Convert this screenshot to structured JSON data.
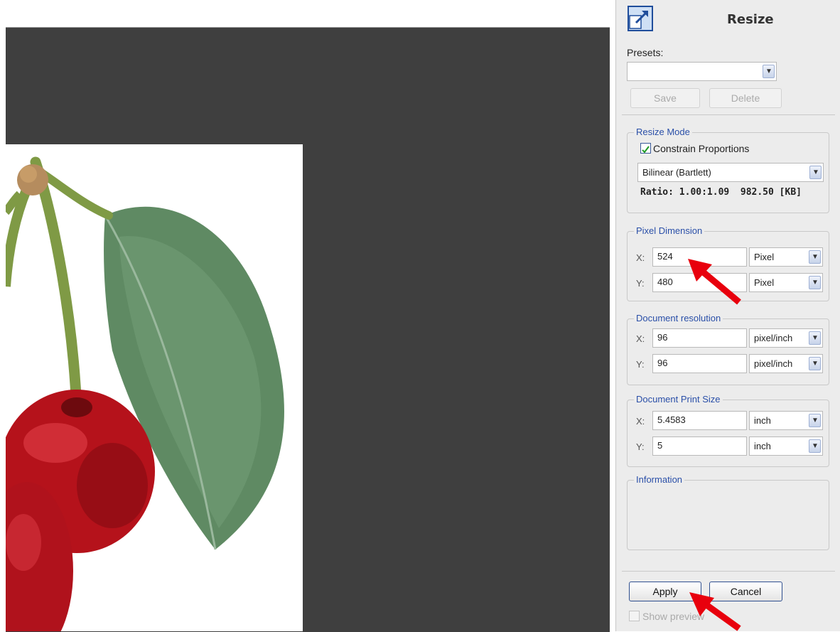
{
  "panel": {
    "title": "Resize",
    "icon": "resize-icon",
    "presets": {
      "label": "Presets:",
      "selected": "",
      "save_label": "Save",
      "delete_label": "Delete"
    },
    "resize_mode": {
      "title": "Resize Mode",
      "constrain_label": "Constrain Proportions",
      "constrain_checked": true,
      "method": "Bilinear (Bartlett)",
      "ratio_text": "Ratio: 1.00:1.09  982.50 [KB]"
    },
    "pixel_dimension": {
      "title": "Pixel Dimension",
      "x_label": "X:",
      "x_value": "524",
      "x_unit": "Pixel",
      "y_label": "Y:",
      "y_value": "480",
      "y_unit": "Pixel"
    },
    "document_resolution": {
      "title": "Document resolution",
      "x_label": "X:",
      "x_value": "96",
      "x_unit": "pixel/inch",
      "y_label": "Y:",
      "y_value": "96",
      "y_unit": "pixel/inch"
    },
    "document_print_size": {
      "title": "Document Print Size",
      "x_label": "X:",
      "x_value": "5.4583",
      "x_unit": "inch",
      "y_label": "Y:",
      "y_value": "5",
      "y_unit": "inch"
    },
    "information": {
      "title": "Information"
    },
    "apply_label": "Apply",
    "cancel_label": "Cancel",
    "show_preview_label": "Show preview"
  },
  "colors": {
    "canvas_bg": "#3f3f3f",
    "panel_bg": "#ececec",
    "group_title": "#2a4fa8",
    "arrow": "#e8000d"
  }
}
